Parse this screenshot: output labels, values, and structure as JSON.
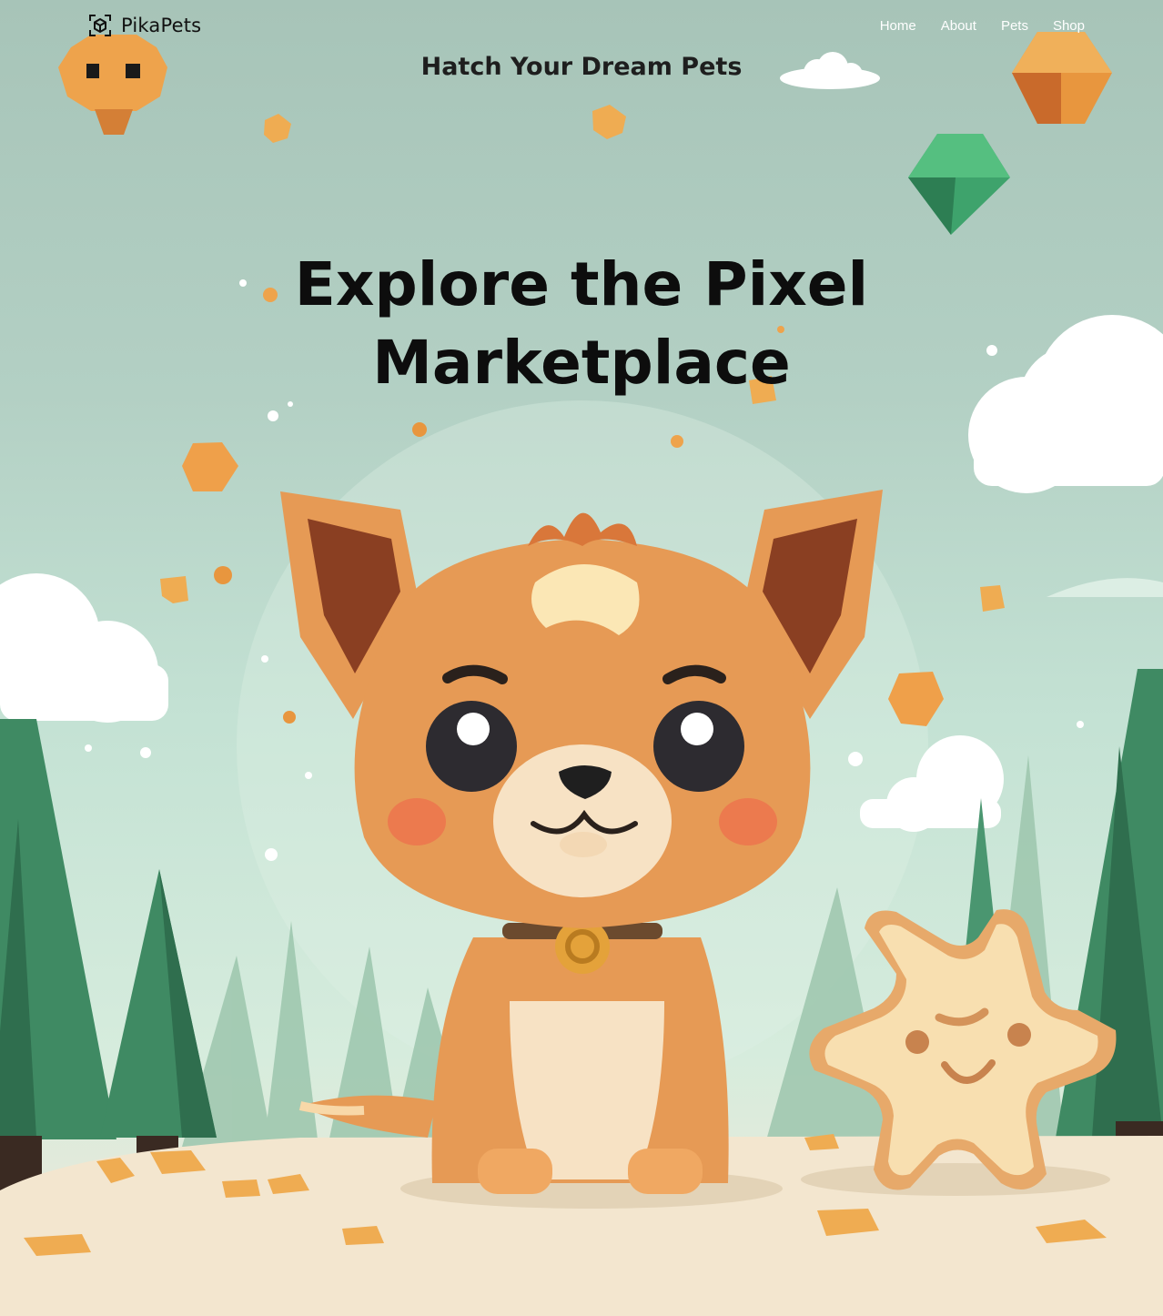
{
  "brand": {
    "name": "PikaPets",
    "logo_icon": "cube-scan-icon"
  },
  "nav": {
    "items": [
      "Home",
      "About",
      "Pets",
      "Shop"
    ]
  },
  "hero": {
    "tagline": "Hatch Your Dream Pets",
    "title_line1": "Explore the Pixel",
    "title_line2": "Marketplace"
  },
  "illustration": {
    "subjects": [
      "pet-dog",
      "star-cookie",
      "pixel-gem",
      "cloud",
      "pine-tree"
    ]
  },
  "colors": {
    "sky_top": "#a7c4b8",
    "sky_bottom": "#d6ecdd",
    "ground": "#f3e6cf",
    "pet_orange": "#e69a55",
    "tree_green": "#3f8a63",
    "gem_green": "#3ea36c",
    "gem_orange": "#e8963e",
    "nav_text": "#ffffff",
    "title_text": "#0d0d0d"
  }
}
